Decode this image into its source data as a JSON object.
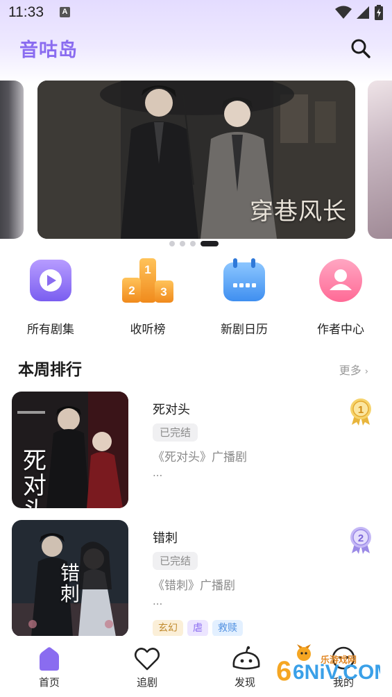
{
  "status_bar": {
    "time": "11:33",
    "notification_letter": "A"
  },
  "header": {
    "app_title": "音咕岛"
  },
  "banner": {
    "title": "穿巷风长",
    "page_count": 4,
    "active_page": 4
  },
  "quick_entries": [
    {
      "label": "所有剧集",
      "icon": "play-icon",
      "color": "#8a6cf0"
    },
    {
      "label": "收听榜",
      "icon": "podium-icon",
      "color": "#f7a43a",
      "podium_numbers": [
        "1",
        "2",
        "3"
      ]
    },
    {
      "label": "新剧日历",
      "icon": "calendar-icon",
      "color": "#4f9df5"
    },
    {
      "label": "作者中心",
      "icon": "user-icon",
      "color": "#ff7fa4"
    }
  ],
  "weekly_rank": {
    "title": "本周排行",
    "more_label": "更多",
    "items": [
      {
        "rank": "1",
        "title": "死对头",
        "status": "已完结",
        "desc": "《死对头》广播剧",
        "ellipsis": "...",
        "cover_title": "死对头",
        "badge_color": "#f2c94c",
        "genres": []
      },
      {
        "rank": "2",
        "title": "错刺",
        "status": "已完结",
        "desc": "《错刺》广播剧",
        "ellipsis": "...",
        "cover_title": "错刺",
        "badge_color": "#a796f0",
        "genres": [
          {
            "label": "玄幻",
            "bg": "#fbefd8",
            "color": "#c08a2e"
          },
          {
            "label": "虐",
            "bg": "#ece5ff",
            "color": "#8a6cf0"
          },
          {
            "label": "救赎",
            "bg": "#e3f0ff",
            "color": "#4f8fe0"
          }
        ]
      }
    ]
  },
  "bottom_nav": [
    {
      "label": "首页",
      "icon": "home-icon",
      "active": true
    },
    {
      "label": "追剧",
      "icon": "heart-icon",
      "active": false
    },
    {
      "label": "发现",
      "icon": "discover-icon",
      "active": false
    },
    {
      "label": "我的",
      "icon": "profile-icon",
      "active": false
    }
  ],
  "watermark": {
    "text": "乐游戏网",
    "logo_text": "6NiV.COM"
  },
  "colors": {
    "accent": "#8a6cf0",
    "header_bg": "#e4dcff"
  }
}
